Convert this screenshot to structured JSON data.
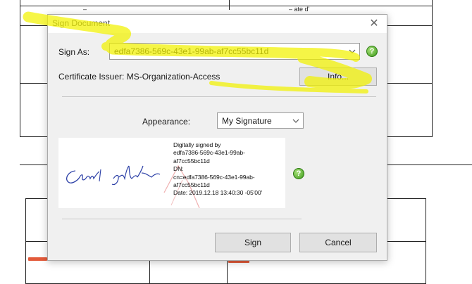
{
  "document": {
    "top_left_text": "–",
    "top_right_text": "– ate d'"
  },
  "dialog": {
    "title": "Sign Document",
    "sign_as_label": "Sign As:",
    "sign_as_value": "edfa7386-569c-43e1-99ab-af7cc55bc11d",
    "issuer_label": "Certificate Issuer: MS-Organization-Access",
    "info_button": "Info...",
    "appearance_label": "Appearance:",
    "appearance_value": "My Signature",
    "preview_lines": [
      "Digitally signed by",
      "edfa7386-569c-43e1-99ab-",
      "af7cc55bc11d",
      "DN:",
      "cn=edfa7386-569c-43e1-99ab-",
      "af7cc55bc11d",
      "Date: 2019.12.18 13:40:30 -05'00'"
    ],
    "sign_button": "Sign",
    "cancel_button": "Cancel"
  },
  "colors": {
    "highlighter": "#f2f200",
    "help_icon": "#3d9a1a",
    "stamp": "#e35a3a"
  }
}
